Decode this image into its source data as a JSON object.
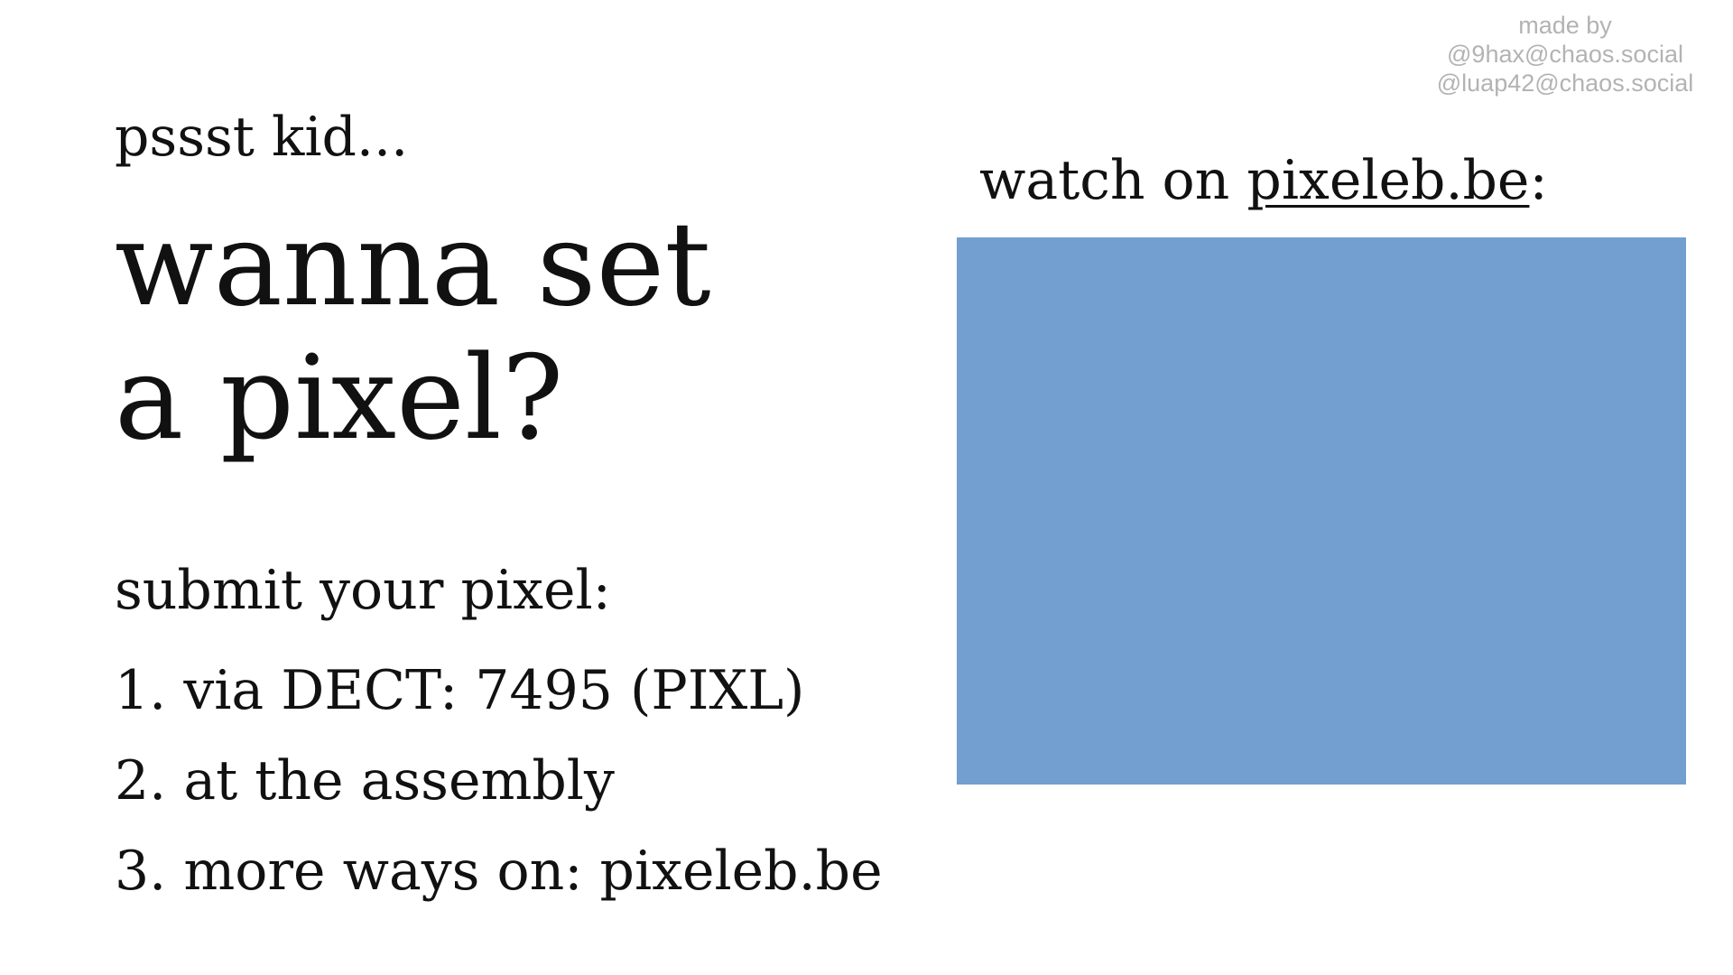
{
  "credits": {
    "made_by": "made by",
    "author_1": "@9hax@chaos.social",
    "author_2": "@luap42@chaos.social"
  },
  "intro": {
    "teaser": "pssst kid...",
    "headline_line_1": "wanna set",
    "headline_line_2": "a pixel?"
  },
  "submit": {
    "title": "submit your pixel:",
    "steps": [
      "1. via DECT: 7495 (PIXL)",
      "2. at the assembly",
      "3. more ways on: pixeleb.be"
    ]
  },
  "watch": {
    "prefix": "watch on ",
    "link_text": "pixeleb.be",
    "suffix": ":"
  },
  "colors": {
    "canvas": "#729fcf",
    "credits_text": "#b3b3b3"
  }
}
